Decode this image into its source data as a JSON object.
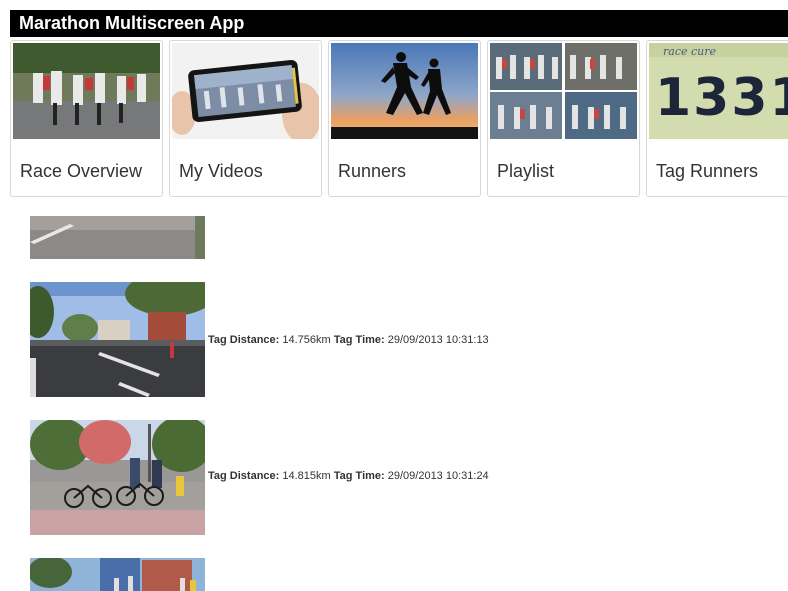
{
  "app": {
    "title": "Marathon Multiscreen App"
  },
  "tiles": [
    {
      "label": "Race Overview"
    },
    {
      "label": "My Videos"
    },
    {
      "label": "Runners"
    },
    {
      "label": "Playlist"
    },
    {
      "label": "Tag Runners",
      "bib_number": "1331",
      "bib_brand": "race cure"
    }
  ],
  "tags": [
    {
      "distance_label": "Tag Distance:",
      "distance": "14.756km",
      "time_label": "Tag Time:",
      "time": "29/09/2013 10:31:13"
    },
    {
      "distance_label": "Tag Distance:",
      "distance": "14.815km",
      "time_label": "Tag Time:",
      "time": "29/09/2013 10:31:24"
    }
  ]
}
